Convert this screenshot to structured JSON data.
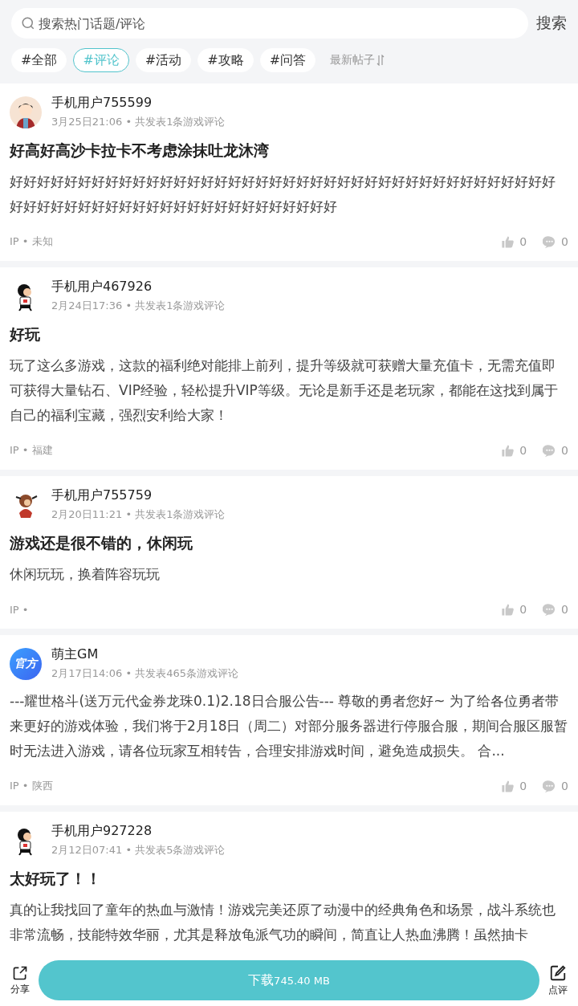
{
  "search": {
    "placeholder": "搜索热门话题/评论",
    "button": "搜索"
  },
  "tags": [
    {
      "label": "#全部",
      "selected": false
    },
    {
      "label": "#评论",
      "selected": true
    },
    {
      "label": "#活动",
      "selected": false
    },
    {
      "label": "#攻略",
      "selected": false
    },
    {
      "label": "#问答",
      "selected": false
    }
  ],
  "sort": {
    "label": "最新帖子"
  },
  "posts": [
    {
      "avatar": {
        "kind": "boy"
      },
      "user": "手机用户755599",
      "meta": "3月25日21:06 • 共发表1条游戏评论",
      "title": "好高好高沙卡拉卡不考虑涂抹吐龙沐湾",
      "body": "好好好好好好好好好好好好好好好好好好好好好好好好好好好好好好好好好好好好好好好好好好好好好好好好好好好好好好好好好好好好好好好好",
      "ip": "IP • 未知",
      "likes": "0",
      "comments": "0"
    },
    {
      "avatar": {
        "kind": "cartoon"
      },
      "user": "手机用户467926",
      "meta": "2月24日17:36 • 共发表1条游戏评论",
      "title": "好玩",
      "body": "玩了这么多游戏，这款的福利绝对能排上前列，提升等级就可获赠大量充值卡，无需充值即可获得大量钻石、VIP经验，轻松提升VIP等级。无论是新手还是老玩家，都能在这找到属于自己的福利宝藏，强烈安利给大家！",
      "ip": "IP • 福建",
      "likes": "0",
      "comments": "0"
    },
    {
      "avatar": {
        "kind": "monkey"
      },
      "user": "手机用户755759",
      "meta": "2月20日11:21 • 共发表1条游戏评论",
      "title": "游戏还是很不错的，休闲玩",
      "body": "休闲玩玩，换着阵容玩玩",
      "ip": "IP •",
      "likes": "0",
      "comments": "0"
    },
    {
      "avatar": {
        "kind": "official",
        "label": "官方"
      },
      "user": "萌主GM",
      "meta": "2月17日14:06 • 共发表465条游戏评论",
      "body": "---耀世格斗(送万元代金券龙珠0.1)2.18日合服公告--- 尊敬的勇者您好~ 为了给各位勇者带来更好的游戏体验，我们将于2月18日（周二）对部分服务器进行停服合服，期间合服区服暂时无法进入游戏，请各位玩家互相转告，合理安排游戏时间，避免造成损失。 合...",
      "ip": "IP • 陕西",
      "likes": "0",
      "comments": "0"
    },
    {
      "avatar": {
        "kind": "cartoon"
      },
      "user": "手机用户927228",
      "meta": "2月12日07:41 • 共发表5条游戏评论",
      "title": "太好玩了！！",
      "body": "真的让我找回了童年的热血与激情！游戏完美还原了动漫中的经典角色和场景，战斗系统也非常流畅，技能特效华丽，尤其是释放龟派气功的瞬间，简直让人热血沸腾！虽然抽卡"
    }
  ],
  "bottom_bar": {
    "share": "分享",
    "download": "下载",
    "size": "745.40 MB",
    "review": "点评"
  }
}
